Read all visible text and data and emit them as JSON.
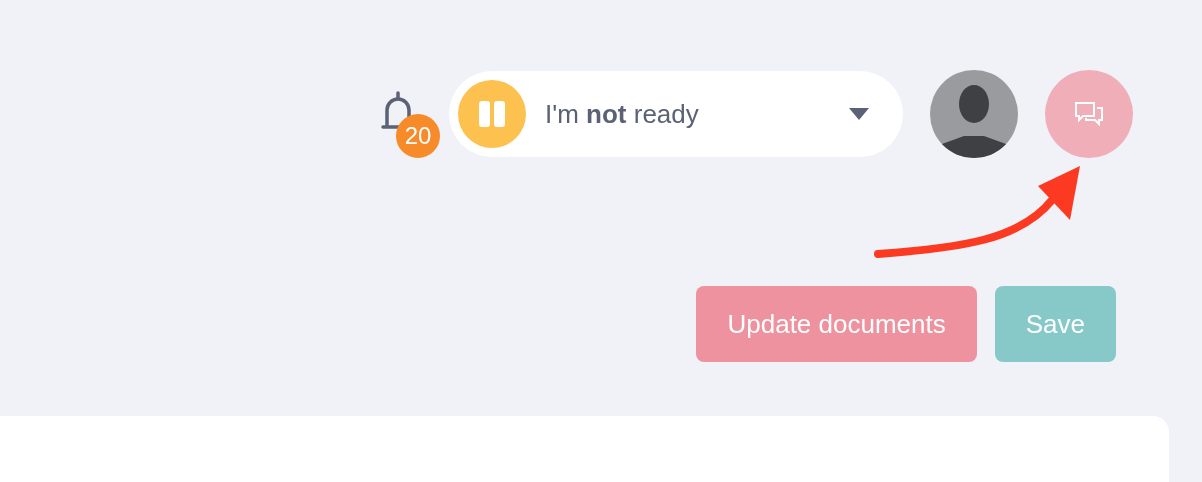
{
  "header": {
    "notifications": {
      "count": "20"
    },
    "status": {
      "label": "I'm **not** ready"
    }
  },
  "actions": [
    {
      "label": "Update documents",
      "kind": "primary"
    },
    {
      "label": "Save",
      "kind": "secondary"
    }
  ]
}
